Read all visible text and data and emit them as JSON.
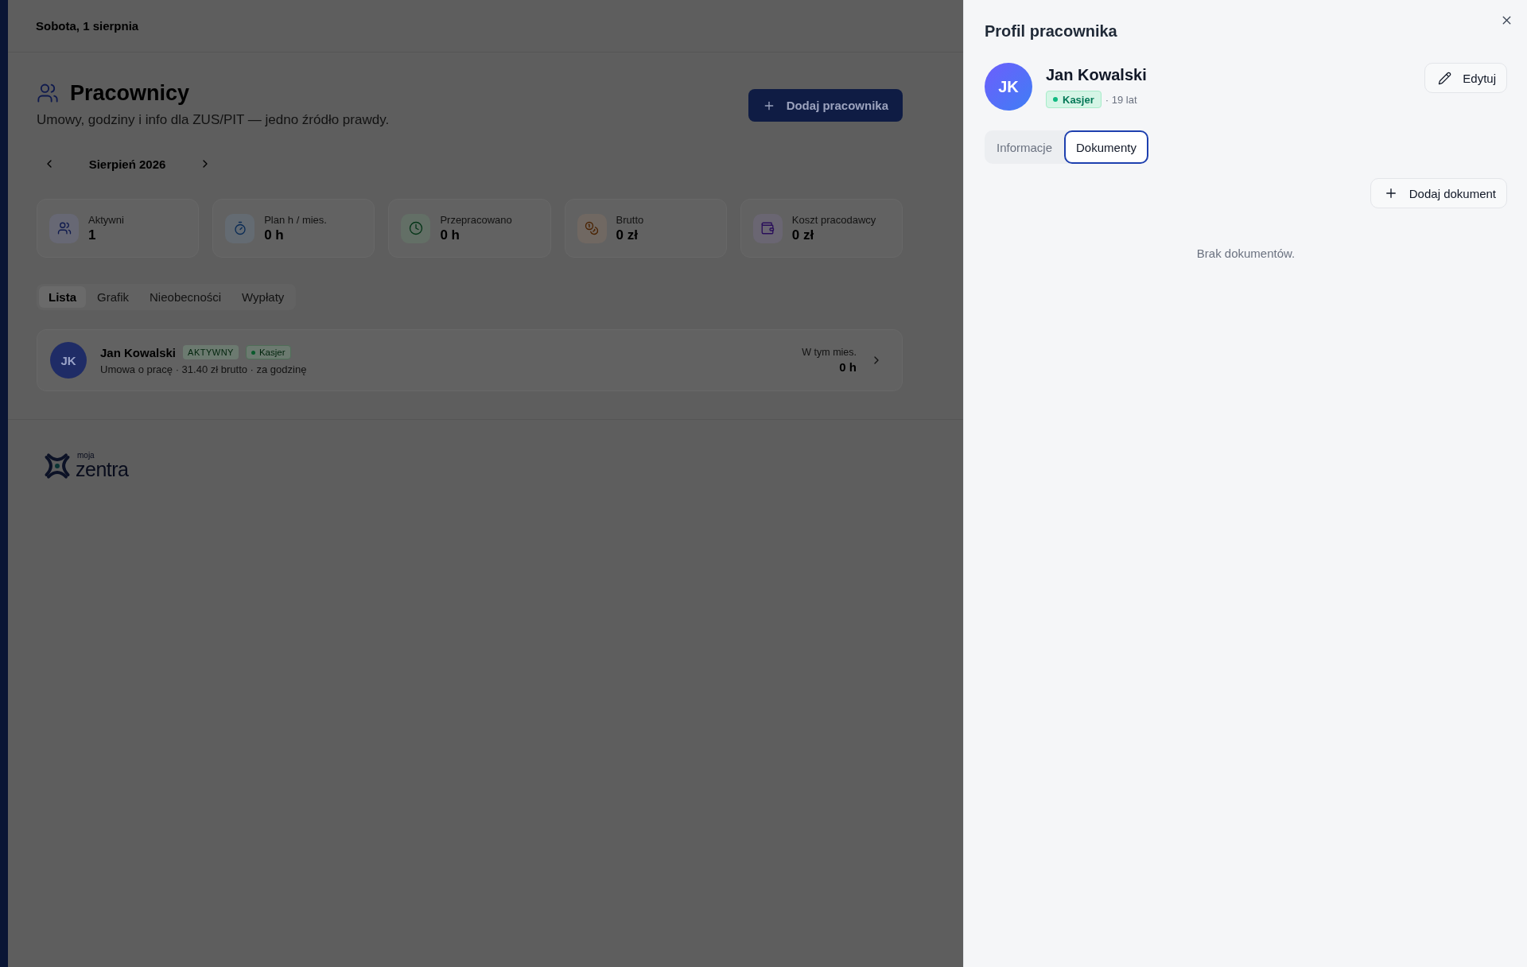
{
  "header": {
    "date": "Sobota, 1 sierpnia"
  },
  "page": {
    "title": "Pracownicy",
    "subtitle": "Umowy, godziny i info dla ZUS/PIT — jedno źródło prawdy.",
    "add_button": "Dodaj pracownika",
    "month": "Sierpień 2026"
  },
  "stats": [
    {
      "kind": "people",
      "label": "Aktywni",
      "value": "1"
    },
    {
      "kind": "timer",
      "label": "Plan h / mies.",
      "value": "0 h"
    },
    {
      "kind": "clock",
      "label": "Przepracowano",
      "value": "0 h"
    },
    {
      "kind": "coins",
      "label": "Brutto",
      "value": "0 zł"
    },
    {
      "kind": "wallet",
      "label": "Koszt pracodawcy",
      "value": "0 zł"
    }
  ],
  "tabs": [
    {
      "label": "Lista",
      "selected": true
    },
    {
      "label": "Grafik",
      "selected": false
    },
    {
      "label": "Nieobecności",
      "selected": false
    },
    {
      "label": "Wypłaty",
      "selected": false
    }
  ],
  "employees": [
    {
      "initials": "JK",
      "name": "Jan Kowalski",
      "status": "AKTYWNY",
      "role": "Kasjer",
      "details": "Umowa o pracę · 31.40 zł brutto · za godzinę",
      "month_label": "W tym mies.",
      "month_hours": "0 h"
    }
  ],
  "logo": {
    "small": "moja",
    "name": "zentra"
  },
  "drawer": {
    "title": "Profil pracownika",
    "initials": "JK",
    "name": "Jan Kowalski",
    "role": "Kasjer",
    "age": "· 19 lat",
    "edit_button": "Edytuj",
    "tabs": [
      {
        "label": "Informacje",
        "selected": false
      },
      {
        "label": "Dokumenty",
        "selected": true
      }
    ],
    "add_button": "Dodaj dokument",
    "empty_text": "Brak dokumentów."
  }
}
